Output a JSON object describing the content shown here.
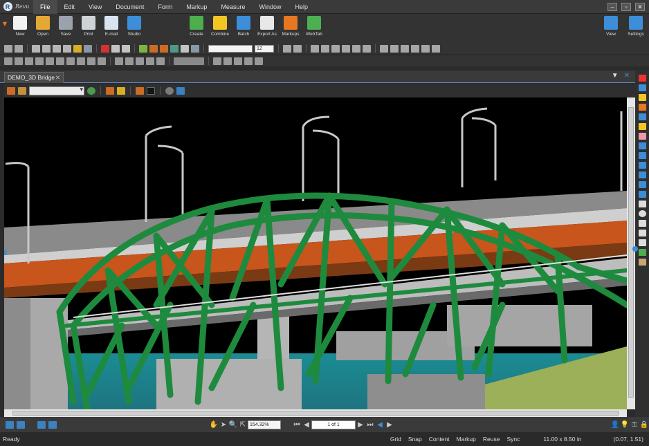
{
  "app": {
    "wordmark": "Revu"
  },
  "menu": [
    "File",
    "Edit",
    "View",
    "Document",
    "Form",
    "Markup",
    "Measure",
    "Window",
    "Help"
  ],
  "menu_active": "File",
  "ribbon": {
    "left": [
      {
        "label": "New",
        "icon": "new-document-icon",
        "color": "#f2f2f2"
      },
      {
        "label": "Open",
        "icon": "open-folder-icon",
        "color": "#e6a834"
      },
      {
        "label": "Save",
        "icon": "save-disk-icon",
        "color": "#9aa3ad"
      },
      {
        "label": "Print",
        "icon": "printer-icon",
        "color": "#cfd3d8"
      },
      {
        "label": "E-mail",
        "icon": "envelope-icon",
        "color": "#d8e4f0"
      },
      {
        "label": "Studio",
        "icon": "studio-cloud-icon",
        "color": "#3d8ed8"
      }
    ],
    "middle": [
      {
        "label": "Create",
        "icon": "create-pdf-icon",
        "color": "#4cae4c"
      },
      {
        "label": "Combine",
        "icon": "combine-icon",
        "color": "#f3c623"
      },
      {
        "label": "Batch",
        "icon": "batch-icon",
        "color": "#3d8ed8"
      },
      {
        "label": "Export As",
        "icon": "export-icon",
        "color": "#e8e8e8"
      },
      {
        "label": "Markups",
        "icon": "markups-icon",
        "color": "#e87722"
      },
      {
        "label": "WebTab",
        "icon": "webtab-globe-icon",
        "color": "#4caf50"
      }
    ],
    "right": [
      {
        "label": "View",
        "icon": "monitor-icon",
        "color": "#3d8ed8"
      },
      {
        "label": "Settings",
        "icon": "settings-gear-icon",
        "color": "#3d8ed8"
      }
    ]
  },
  "format_toolbar": {
    "font_size": "12"
  },
  "document": {
    "tab_title": "DEMO_3D Bridge"
  },
  "nav": {
    "zoom": "154.32%",
    "page": "1 of 1"
  },
  "status": {
    "ready": "Ready",
    "toggles": [
      "Grid",
      "Snap",
      "Content",
      "Markup",
      "Reuse",
      "Sync"
    ],
    "page_size": "11.00 x 8.50 in",
    "coords": "(0.07, 1.51)"
  }
}
